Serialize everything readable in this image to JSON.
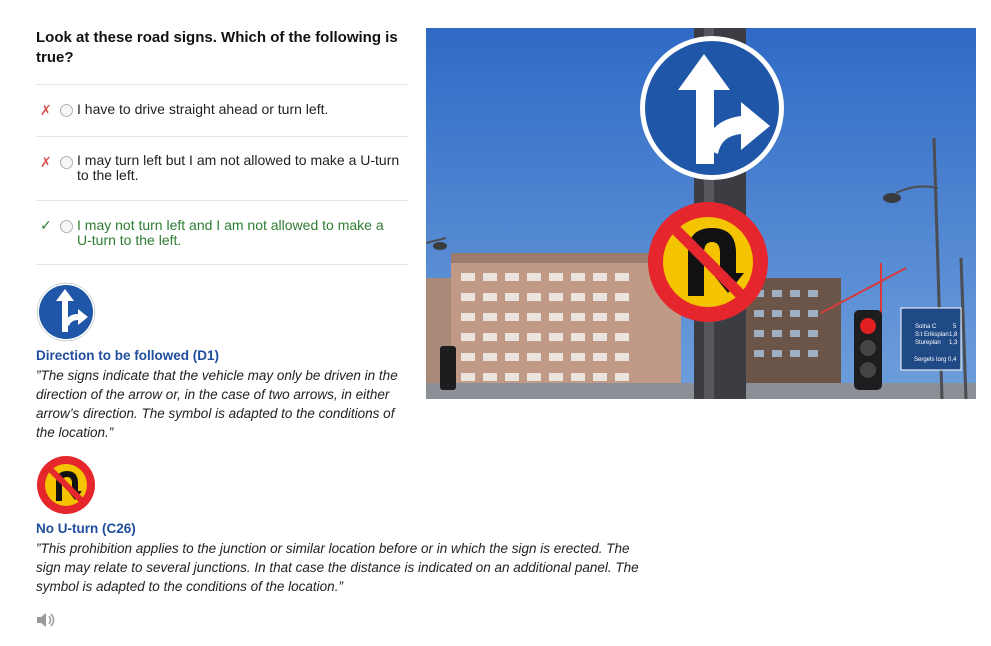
{
  "question": "Look at these road signs. Which of the following is true?",
  "answers": [
    {
      "text": "I have to drive straight ahead or turn left.",
      "status_icon": "x-mark-icon",
      "correct": false
    },
    {
      "text": "I may turn left but I am not allowed to make a U-turn to the left.",
      "status_icon": "x-mark-icon",
      "correct": false
    },
    {
      "text": "I may not turn left and I am not allowed to make a U-turn to the left.",
      "status_icon": "check-mark-icon",
      "correct": true
    }
  ],
  "marks": {
    "wrong": "✗",
    "right": "✓"
  },
  "signs": [
    {
      "title": "Direction to be followed (D1)",
      "description": "”The signs indicate that the vehicle may only be driven in the direction of the arrow or, in the case of two arrows, in either arrow’s direction. The symbol is adapted to the conditions of the location.”",
      "icon": "direction-to-be-followed-sign-icon"
    },
    {
      "title": "No U-turn (C26)",
      "description": "”This prohibition applies to the junction or similar location before or in which the sign is erected. The sign may relate to several junctions. In that case the distance is indicated on an additional panel. The symbol is adapted to the conditions of the location.”",
      "icon": "no-u-turn-sign-icon"
    }
  ],
  "photo": {
    "street_sign": {
      "rows": [
        {
          "dest": "Solna C",
          "dist": "5"
        },
        {
          "dest": "S:t Eriksplan",
          "dist": "1,8"
        },
        {
          "dest": "Stureplan",
          "dist": "1,3"
        }
      ],
      "bottom": {
        "dest": "Sergels torg",
        "dist": "0,4"
      }
    }
  },
  "colors": {
    "sign_blue": "#1f56a8",
    "sign_red": "#e5272d",
    "sign_yellow": "#f5c400",
    "correct_green": "#2e7d32",
    "wrong_red": "#d9534f",
    "title_blue": "#1f4e9c"
  },
  "audio_icon": "speaker-icon"
}
